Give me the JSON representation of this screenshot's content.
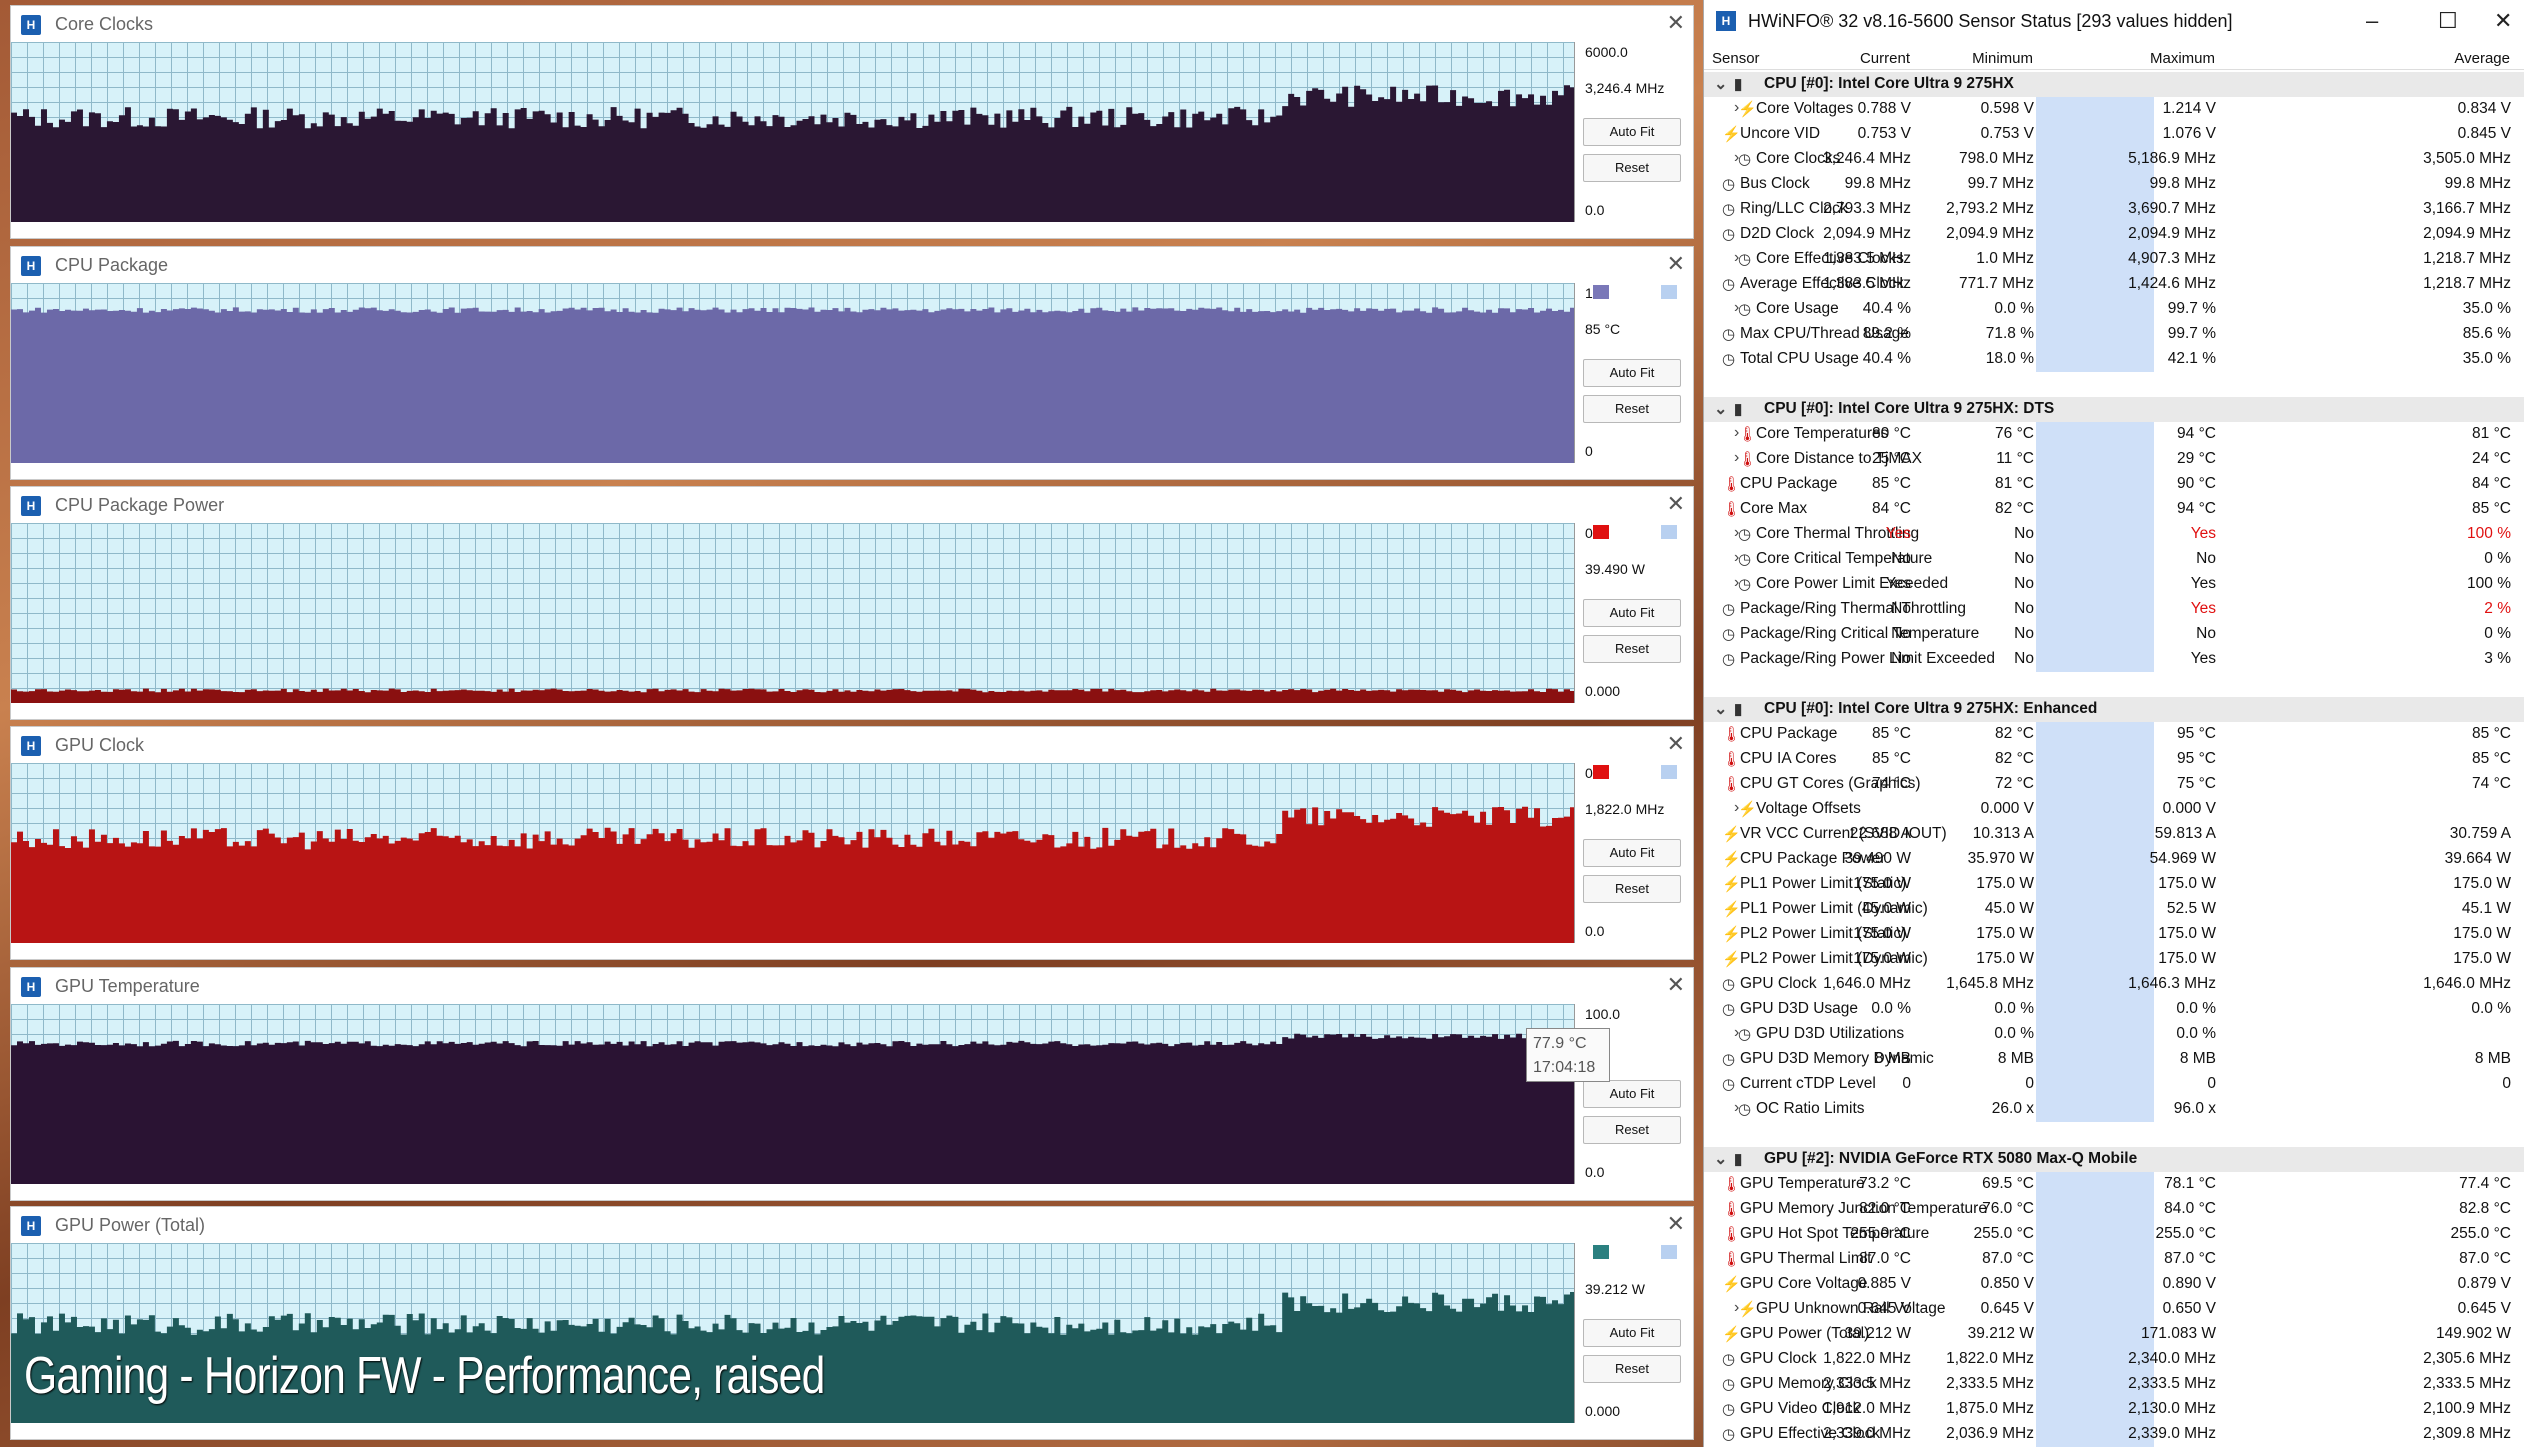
{
  "graphs": [
    {
      "title": "Core Clocks",
      "top_value": "6000.0",
      "current": "3,246.4 MHz",
      "bottom_value": "0.0",
      "color": "#2a1733",
      "level": 0.58,
      "legend": ""
    },
    {
      "title": "CPU Package",
      "top_value": "100",
      "current": "85 °C",
      "bottom_value": "0",
      "color": "#6c69a8",
      "level": 0.85,
      "legend": "#7a78b8"
    },
    {
      "title": "CPU Package Power",
      "top_value": "0.0",
      "current": "39.490 W",
      "bottom_value": "0.000",
      "color": "#8a1010",
      "level": 0.07,
      "legend": "#e01010"
    },
    {
      "title": "GPU Clock",
      "top_value": "00",
      "current": "1,822.0 MHz",
      "bottom_value": "0.0",
      "color": "#b81414",
      "level": 0.58,
      "legend": "#e01010"
    },
    {
      "title": "GPU Temperature",
      "top_value": "100.0",
      "current": "°C",
      "bottom_value": "0.0",
      "color": "#2a1333",
      "level": 0.78,
      "legend": ""
    },
    {
      "title": "GPU Power (Total)",
      "top_value": "",
      "current": "39.212 W",
      "bottom_value": "0.000",
      "color": "#1f5a5a",
      "level": 0.55,
      "legend": "#2b8080"
    }
  ],
  "buttons": {
    "auto_fit": "Auto Fit",
    "reset": "Reset"
  },
  "tooltip": {
    "value": "77.9 °C",
    "time": "17:04:18"
  },
  "caption": "Gaming - Horizon FW - Performance, raised",
  "hwinfo": {
    "title": "HWiNFO® 32 v8.16-5600 Sensor Status [293 values hidden]",
    "columns": {
      "sensor": "Sensor",
      "current": "Current",
      "minimum": "Minimum",
      "maximum": "Maximum",
      "average": "Average"
    },
    "rows": [
      {
        "type": "group",
        "name": "CPU [#0]: Intel Core Ultra 9 275HX"
      },
      {
        "name": "Core Voltages",
        "icon": "bolt",
        "exp": true,
        "cur": "0.788 V",
        "min": "0.598 V",
        "max": "1.214 V",
        "avg": "0.834 V"
      },
      {
        "name": "Uncore VID",
        "icon": "bolt",
        "cur": "0.753 V",
        "min": "0.753 V",
        "max": "1.076 V",
        "avg": "0.845 V"
      },
      {
        "name": "Core Clocks",
        "icon": "clock",
        "exp": true,
        "cur": "3,246.4 MHz",
        "min": "798.0 MHz",
        "max": "5,186.9 MHz",
        "avg": "3,505.0 MHz"
      },
      {
        "name": "Bus Clock",
        "icon": "clock",
        "cur": "99.8 MHz",
        "min": "99.7 MHz",
        "max": "99.8 MHz",
        "avg": "99.8 MHz"
      },
      {
        "name": "Ring/LLC Clock",
        "icon": "clock",
        "cur": "2,793.3 MHz",
        "min": "2,793.2 MHz",
        "max": "3,690.7 MHz",
        "avg": "3,166.7 MHz"
      },
      {
        "name": "D2D Clock",
        "icon": "clock",
        "cur": "2,094.9 MHz",
        "min": "2,094.9 MHz",
        "max": "2,094.9 MHz",
        "avg": "2,094.9 MHz"
      },
      {
        "name": "Core Effective Clocks",
        "icon": "clock",
        "exp": true,
        "cur": "1,383.5 MHz",
        "min": "1.0 MHz",
        "max": "4,907.3 MHz",
        "avg": "1,218.7 MHz"
      },
      {
        "name": "Average Effective Clock",
        "icon": "clock",
        "cur": "1,383.5 MHz",
        "min": "771.7 MHz",
        "max": "1,424.6 MHz",
        "avg": "1,218.7 MHz"
      },
      {
        "name": "Core Usage",
        "icon": "clock",
        "exp": true,
        "cur": "40.4 %",
        "min": "0.0 %",
        "max": "99.7 %",
        "avg": "35.0 %"
      },
      {
        "name": "Max CPU/Thread Usage",
        "icon": "clock",
        "cur": "89.2 %",
        "min": "71.8 %",
        "max": "99.7 %",
        "avg": "85.6 %"
      },
      {
        "name": "Total CPU Usage",
        "icon": "clock",
        "cur": "40.4 %",
        "min": "18.0 %",
        "max": "42.1 %",
        "avg": "35.0 %"
      },
      {
        "type": "gap"
      },
      {
        "type": "group",
        "name": "CPU [#0]: Intel Core Ultra 9 275HX: DTS"
      },
      {
        "name": "Core Temperatures",
        "icon": "therm",
        "exp": true,
        "cur": "80 °C",
        "min": "76 °C",
        "max": "94 °C",
        "avg": "81 °C"
      },
      {
        "name": "Core Distance to TjMAX",
        "icon": "therm",
        "exp": true,
        "cur": "25 °C",
        "min": "11 °C",
        "max": "29 °C",
        "avg": "24 °C"
      },
      {
        "name": "CPU Package",
        "icon": "therm",
        "cur": "85 °C",
        "min": "81 °C",
        "max": "90 °C",
        "avg": "84 °C"
      },
      {
        "name": "Core Max",
        "icon": "therm",
        "cur": "84 °C",
        "min": "82 °C",
        "max": "94 °C",
        "avg": "85 °C"
      },
      {
        "name": "Core Thermal Throttling",
        "icon": "clock",
        "exp": true,
        "cur": "Yes",
        "min": "No",
        "max": "Yes",
        "avg": "100 %",
        "red": [
          "cur",
          "max",
          "avg"
        ]
      },
      {
        "name": "Core Critical Temperature",
        "icon": "clock",
        "exp": true,
        "cur": "No",
        "min": "No",
        "max": "No",
        "avg": "0 %"
      },
      {
        "name": "Core Power Limit Exceeded",
        "icon": "clock",
        "exp": true,
        "cur": "Yes",
        "min": "No",
        "max": "Yes",
        "avg": "100 %"
      },
      {
        "name": "Package/Ring Thermal Throttling",
        "icon": "clock",
        "cur": "No",
        "min": "No",
        "max": "Yes",
        "avg": "2 %",
        "red": [
          "max",
          "avg"
        ]
      },
      {
        "name": "Package/Ring Critical Temperature",
        "icon": "clock",
        "cur": "No",
        "min": "No",
        "max": "No",
        "avg": "0 %"
      },
      {
        "name": "Package/Ring Power Limit Exceeded",
        "icon": "clock",
        "cur": "No",
        "min": "No",
        "max": "Yes",
        "avg": "3 %"
      },
      {
        "type": "gap"
      },
      {
        "type": "group",
        "name": "CPU [#0]: Intel Core Ultra 9 275HX: Enhanced"
      },
      {
        "name": "CPU Package",
        "icon": "therm",
        "cur": "85 °C",
        "min": "82 °C",
        "max": "95 °C",
        "avg": "85 °C"
      },
      {
        "name": "CPU IA Cores",
        "icon": "therm",
        "cur": "85 °C",
        "min": "82 °C",
        "max": "95 °C",
        "avg": "85 °C"
      },
      {
        "name": "CPU GT Cores (Graphics)",
        "icon": "therm",
        "cur": "74 °C",
        "min": "72 °C",
        "max": "75 °C",
        "avg": "74 °C"
      },
      {
        "name": "Voltage Offsets",
        "icon": "bolt",
        "exp": true,
        "cur": "",
        "min": "0.000 V",
        "max": "0.000 V",
        "avg": ""
      },
      {
        "name": "VR VCC Current (SVID IOUT)",
        "icon": "bolt",
        "cur": "22.688 A",
        "min": "10.313 A",
        "max": "59.813 A",
        "avg": "30.759 A"
      },
      {
        "name": "CPU Package Power",
        "icon": "bolt",
        "cur": "39.490 W",
        "min": "35.970 W",
        "max": "54.969 W",
        "avg": "39.664 W"
      },
      {
        "name": "PL1 Power Limit (Static)",
        "icon": "bolt",
        "cur": "175.0 W",
        "min": "175.0 W",
        "max": "175.0 W",
        "avg": "175.0 W"
      },
      {
        "name": "PL1 Power Limit (Dynamic)",
        "icon": "bolt",
        "cur": "45.0 W",
        "min": "45.0 W",
        "max": "52.5 W",
        "avg": "45.1 W"
      },
      {
        "name": "PL2 Power Limit (Static)",
        "icon": "bolt",
        "cur": "175.0 W",
        "min": "175.0 W",
        "max": "175.0 W",
        "avg": "175.0 W"
      },
      {
        "name": "PL2 Power Limit (Dynamic)",
        "icon": "bolt",
        "cur": "175.0 W",
        "min": "175.0 W",
        "max": "175.0 W",
        "avg": "175.0 W"
      },
      {
        "name": "GPU Clock",
        "icon": "clock",
        "cur": "1,646.0 MHz",
        "min": "1,645.8 MHz",
        "max": "1,646.3 MHz",
        "avg": "1,646.0 MHz"
      },
      {
        "name": "GPU D3D Usage",
        "icon": "clock",
        "cur": "0.0 %",
        "min": "0.0 %",
        "max": "0.0 %",
        "avg": "0.0 %"
      },
      {
        "name": "GPU D3D Utilizations",
        "icon": "clock",
        "exp": true,
        "cur": "",
        "min": "0.0 %",
        "max": "0.0 %",
        "avg": ""
      },
      {
        "name": "GPU D3D Memory Dynamic",
        "icon": "clock",
        "cur": "8 MB",
        "min": "8 MB",
        "max": "8 MB",
        "avg": "8 MB"
      },
      {
        "name": "Current cTDP Level",
        "icon": "clock",
        "cur": "0",
        "min": "0",
        "max": "0",
        "avg": "0"
      },
      {
        "name": "OC Ratio Limits",
        "icon": "clock",
        "exp": true,
        "cur": "",
        "min": "26.0 x",
        "max": "96.0 x",
        "avg": ""
      },
      {
        "type": "gap"
      },
      {
        "type": "group",
        "name": "GPU [#2]: NVIDIA GeForce RTX 5080 Max-Q Mobile"
      },
      {
        "name": "GPU Temperature",
        "icon": "therm",
        "cur": "73.2 °C",
        "min": "69.5 °C",
        "max": "78.1 °C",
        "avg": "77.4 °C"
      },
      {
        "name": "GPU Memory Junction Temperature",
        "icon": "therm",
        "cur": "82.0 °C",
        "min": "76.0 °C",
        "max": "84.0 °C",
        "avg": "82.8 °C"
      },
      {
        "name": "GPU Hot Spot Temperature",
        "icon": "therm",
        "cur": "255.0 °C",
        "min": "255.0 °C",
        "max": "255.0 °C",
        "avg": "255.0 °C"
      },
      {
        "name": "GPU Thermal Limit",
        "icon": "therm",
        "cur": "87.0 °C",
        "min": "87.0 °C",
        "max": "87.0 °C",
        "avg": "87.0 °C"
      },
      {
        "name": "GPU Core Voltage",
        "icon": "bolt",
        "cur": "0.885 V",
        "min": "0.850 V",
        "max": "0.890 V",
        "avg": "0.879 V"
      },
      {
        "name": "GPU Unknown Rail Voltage",
        "icon": "bolt",
        "exp": true,
        "cur": "0.645 V",
        "min": "0.645 V",
        "max": "0.650 V",
        "avg": "0.645 V"
      },
      {
        "name": "GPU Power (Total)",
        "icon": "bolt",
        "cur": "39.212 W",
        "min": "39.212 W",
        "max": "171.083 W",
        "avg": "149.902 W"
      },
      {
        "name": "GPU Clock",
        "icon": "clock",
        "cur": "1,822.0 MHz",
        "min": "1,822.0 MHz",
        "max": "2,340.0 MHz",
        "avg": "2,305.6 MHz"
      },
      {
        "name": "GPU Memory Clock",
        "icon": "clock",
        "cur": "2,333.5 MHz",
        "min": "2,333.5 MHz",
        "max": "2,333.5 MHz",
        "avg": "2,333.5 MHz"
      },
      {
        "name": "GPU Video Clock",
        "icon": "clock",
        "cur": "1,912.0 MHz",
        "min": "1,875.0 MHz",
        "max": "2,130.0 MHz",
        "avg": "2,100.9 MHz"
      },
      {
        "name": "GPU Effective Clock",
        "icon": "clock",
        "cur": "2,339.0 MHz",
        "min": "2,036.9 MHz",
        "max": "2,339.0 MHz",
        "avg": "2,309.8 MHz"
      }
    ]
  }
}
